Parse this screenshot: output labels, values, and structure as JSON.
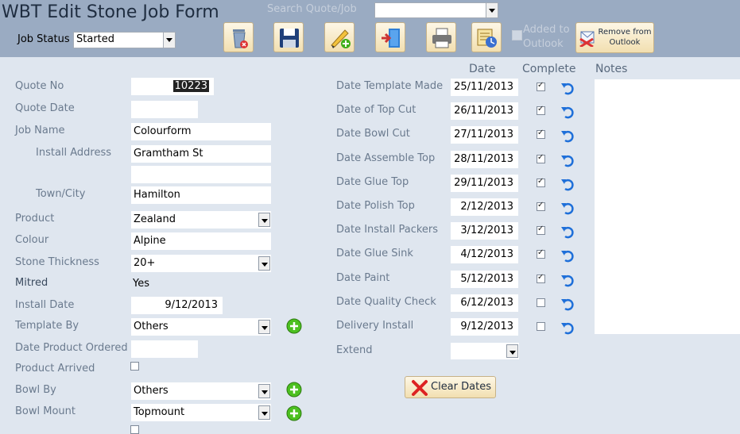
{
  "header": {
    "title": "WBT Edit Stone Job Form",
    "job_status_label": "Job Status",
    "job_status_value": "Started",
    "search_label": "Search Quote/Job",
    "search_value": "",
    "added_to_outlook_label": "Added to Outlook",
    "added_to_outlook_checked": false,
    "remove_from_outlook_label": "Remove from Outlook"
  },
  "toolbar": {
    "icons": [
      "delete-icon",
      "save-icon",
      "edit-add-icon",
      "exit-icon",
      "print-icon",
      "schedule-icon"
    ]
  },
  "form": {
    "quote_no_label": "Quote No",
    "quote_no": "10223",
    "quote_date_label": "Quote Date",
    "quote_date": "",
    "job_name_label": "Job Name",
    "job_name": "Colourform",
    "install_address_label": "Install Address",
    "install_address_1": "Gramtham St",
    "install_address_2": "",
    "town_label": "Town/City",
    "town": "Hamilton",
    "product_label": "Product",
    "product": "Zealand",
    "colour_label": "Colour",
    "colour": "Alpine",
    "stone_thickness_label": "Stone Thickness",
    "stone_thickness": "20+",
    "mitred_label": "Mitred",
    "mitred": "Yes",
    "install_date_label": "Install Date",
    "install_date": "9/12/2013",
    "template_by_label": "Template By",
    "template_by": "Others",
    "date_product_ordered_label": "Date Product Ordered",
    "date_product_ordered": "",
    "product_arrived_label": "Product Arrived",
    "product_arrived": false,
    "bowl_by_label": "Bowl By",
    "bowl_by": "Others",
    "bowl_mount_label": "Bowl Mount",
    "bowl_mount": "Topmount"
  },
  "dates": {
    "date_header": "Date",
    "complete_header": "Complete",
    "notes_header": "Notes",
    "rows": [
      {
        "label": "Date Template Made",
        "date": "25/11/2013",
        "complete": true
      },
      {
        "label": "Date of Top Cut",
        "date": "26/11/2013",
        "complete": true
      },
      {
        "label": "Date Bowl Cut",
        "date": "27/11/2013",
        "complete": true
      },
      {
        "label": "Date Assemble Top",
        "date": "28/11/2013",
        "complete": true
      },
      {
        "label": "Date Glue Top",
        "date": "29/11/2013",
        "complete": true
      },
      {
        "label": "Date Polish Top",
        "date": "2/12/2013",
        "complete": true
      },
      {
        "label": "Date Install Packers",
        "date": "3/12/2013",
        "complete": true
      },
      {
        "label": "Date Glue Sink",
        "date": "4/12/2013",
        "complete": true
      },
      {
        "label": "Date Paint",
        "date": "5/12/2013",
        "complete": true
      },
      {
        "label": "Date Quality Check",
        "date": "6/12/2013",
        "complete": false
      },
      {
        "label": "Delivery Install",
        "date": "9/12/2013",
        "complete": false
      }
    ],
    "extend_label": "Extend",
    "extend_value": "",
    "notes": "",
    "clear_dates_label": "Clear Dates"
  },
  "colors": {
    "header_bg": "#9aabc2",
    "body_bg": "#dfe6ef",
    "label_text": "#6a7a8e",
    "button_bg": "#f2dfb0",
    "undo_icon": "#1e6fd9",
    "plus_icon": "#3fae1a"
  }
}
